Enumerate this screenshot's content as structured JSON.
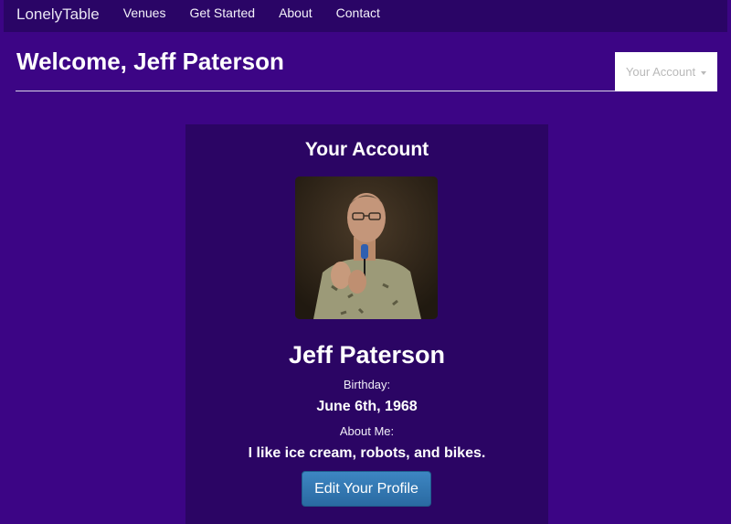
{
  "nav": {
    "brand": "LonelyTable",
    "links": [
      "Venues",
      "Get Started",
      "About",
      "Contact"
    ]
  },
  "header": {
    "welcome": "Welcome, Jeff Paterson",
    "account_dropdown": "Your Account"
  },
  "card": {
    "title": "Your Account",
    "name": "Jeff Paterson",
    "birthday_label": "Birthday:",
    "birthday": "June 6th, 1968",
    "about_label": "About Me:",
    "about": "I like ice cream, robots, and bikes.",
    "edit_button": "Edit Your Profile"
  },
  "colors": {
    "page_background": "#3c0585",
    "navbar": "#2a0566",
    "card": "#2b0564",
    "button": "#3277b4"
  }
}
